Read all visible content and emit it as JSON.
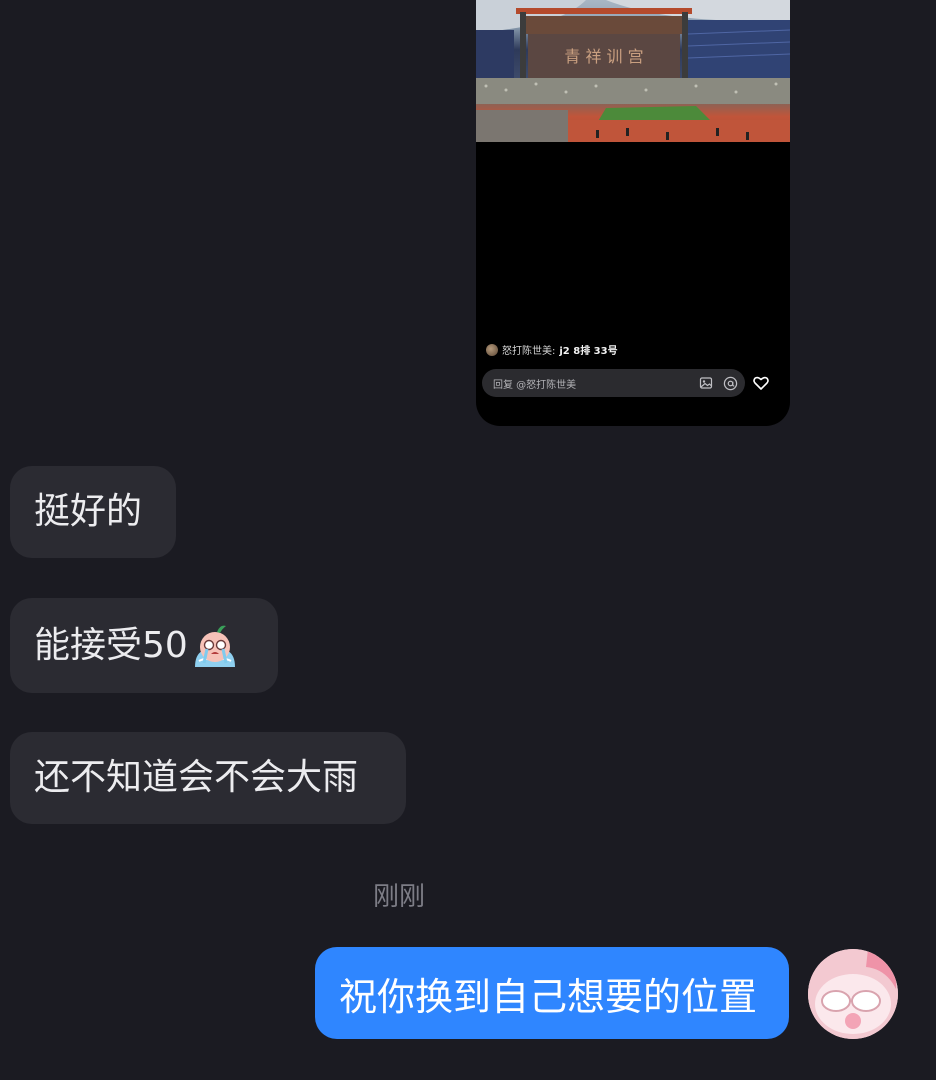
{
  "shared_card": {
    "banner_text": "青 祥 训 宫",
    "comment_user": "怒打陈世美:",
    "comment_text": "j2 8排 33号",
    "reply_placeholder": "回复 @怒打陈世美",
    "icons": [
      "image-icon",
      "at-icon",
      "heart-icon"
    ]
  },
  "messages": {
    "incoming": [
      {
        "text": "挺好的"
      },
      {
        "text": "能接受50",
        "emoji": "crying-emoji"
      },
      {
        "text": "还不知道会不会大雨"
      }
    ],
    "timestamp": "刚刚",
    "outgoing": [
      {
        "text": "祝你换到自己想要的位置"
      }
    ]
  },
  "colors": {
    "background": "#1b1b22",
    "incoming_bubble": "#2b2b32",
    "outgoing_bubble": "#2f86ff"
  }
}
